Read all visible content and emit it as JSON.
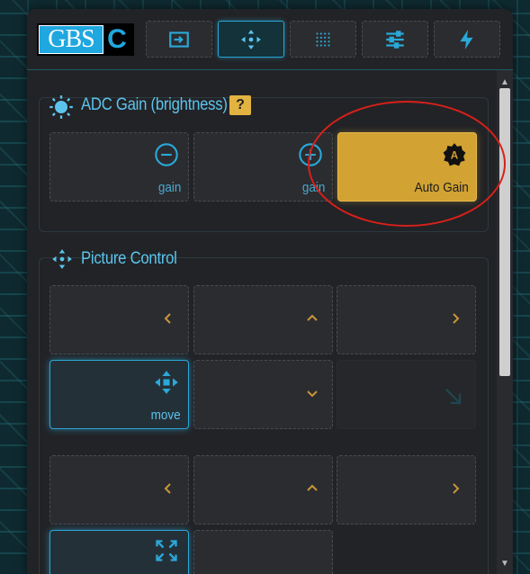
{
  "logo": {
    "part1": "GBS",
    "part2": "C"
  },
  "tabs": [
    {
      "name": "tab-input",
      "icon": "input-icon",
      "active": false
    },
    {
      "name": "tab-picture-control",
      "icon": "move-arrows-icon",
      "active": true
    },
    {
      "name": "tab-filters",
      "icon": "dots-grid-icon",
      "active": false
    },
    {
      "name": "tab-settings",
      "icon": "sliders-icon",
      "active": false
    },
    {
      "name": "tab-system",
      "icon": "lightning-icon",
      "active": false
    }
  ],
  "adc_section": {
    "title": "ADC Gain (brightness)",
    "help": "?",
    "buttons": [
      {
        "label": "gain",
        "icon": "minus-circle-icon"
      },
      {
        "label": "gain",
        "icon": "plus-circle-icon"
      },
      {
        "label": "Auto Gain",
        "icon": "auto-badge-icon",
        "badge_text": "A",
        "highlighted": true
      }
    ]
  },
  "picture_section": {
    "title": "Picture Control",
    "row1": [
      {
        "icon": "chevron-left-icon"
      },
      {
        "icon": "chevron-up-icon"
      },
      {
        "icon": "chevron-right-icon"
      }
    ],
    "row2": [
      {
        "label": "move",
        "icon": "move-arrows-icon",
        "selected": true
      },
      {
        "icon": "chevron-down-icon"
      },
      {
        "icon": "arrow-down-right-icon",
        "disabled": true
      }
    ],
    "row3": [
      {
        "icon": "chevron-left-icon"
      },
      {
        "icon": "chevron-up-icon"
      },
      {
        "icon": "chevron-right-icon"
      }
    ],
    "row4": [
      {
        "icon": "expand-icon",
        "selected": true
      },
      {
        "icon": ""
      }
    ]
  },
  "colors": {
    "accent": "#2aa8d8",
    "chevron": "#c9963a",
    "highlight": "#d2a232",
    "annotation": "#d8201a"
  }
}
